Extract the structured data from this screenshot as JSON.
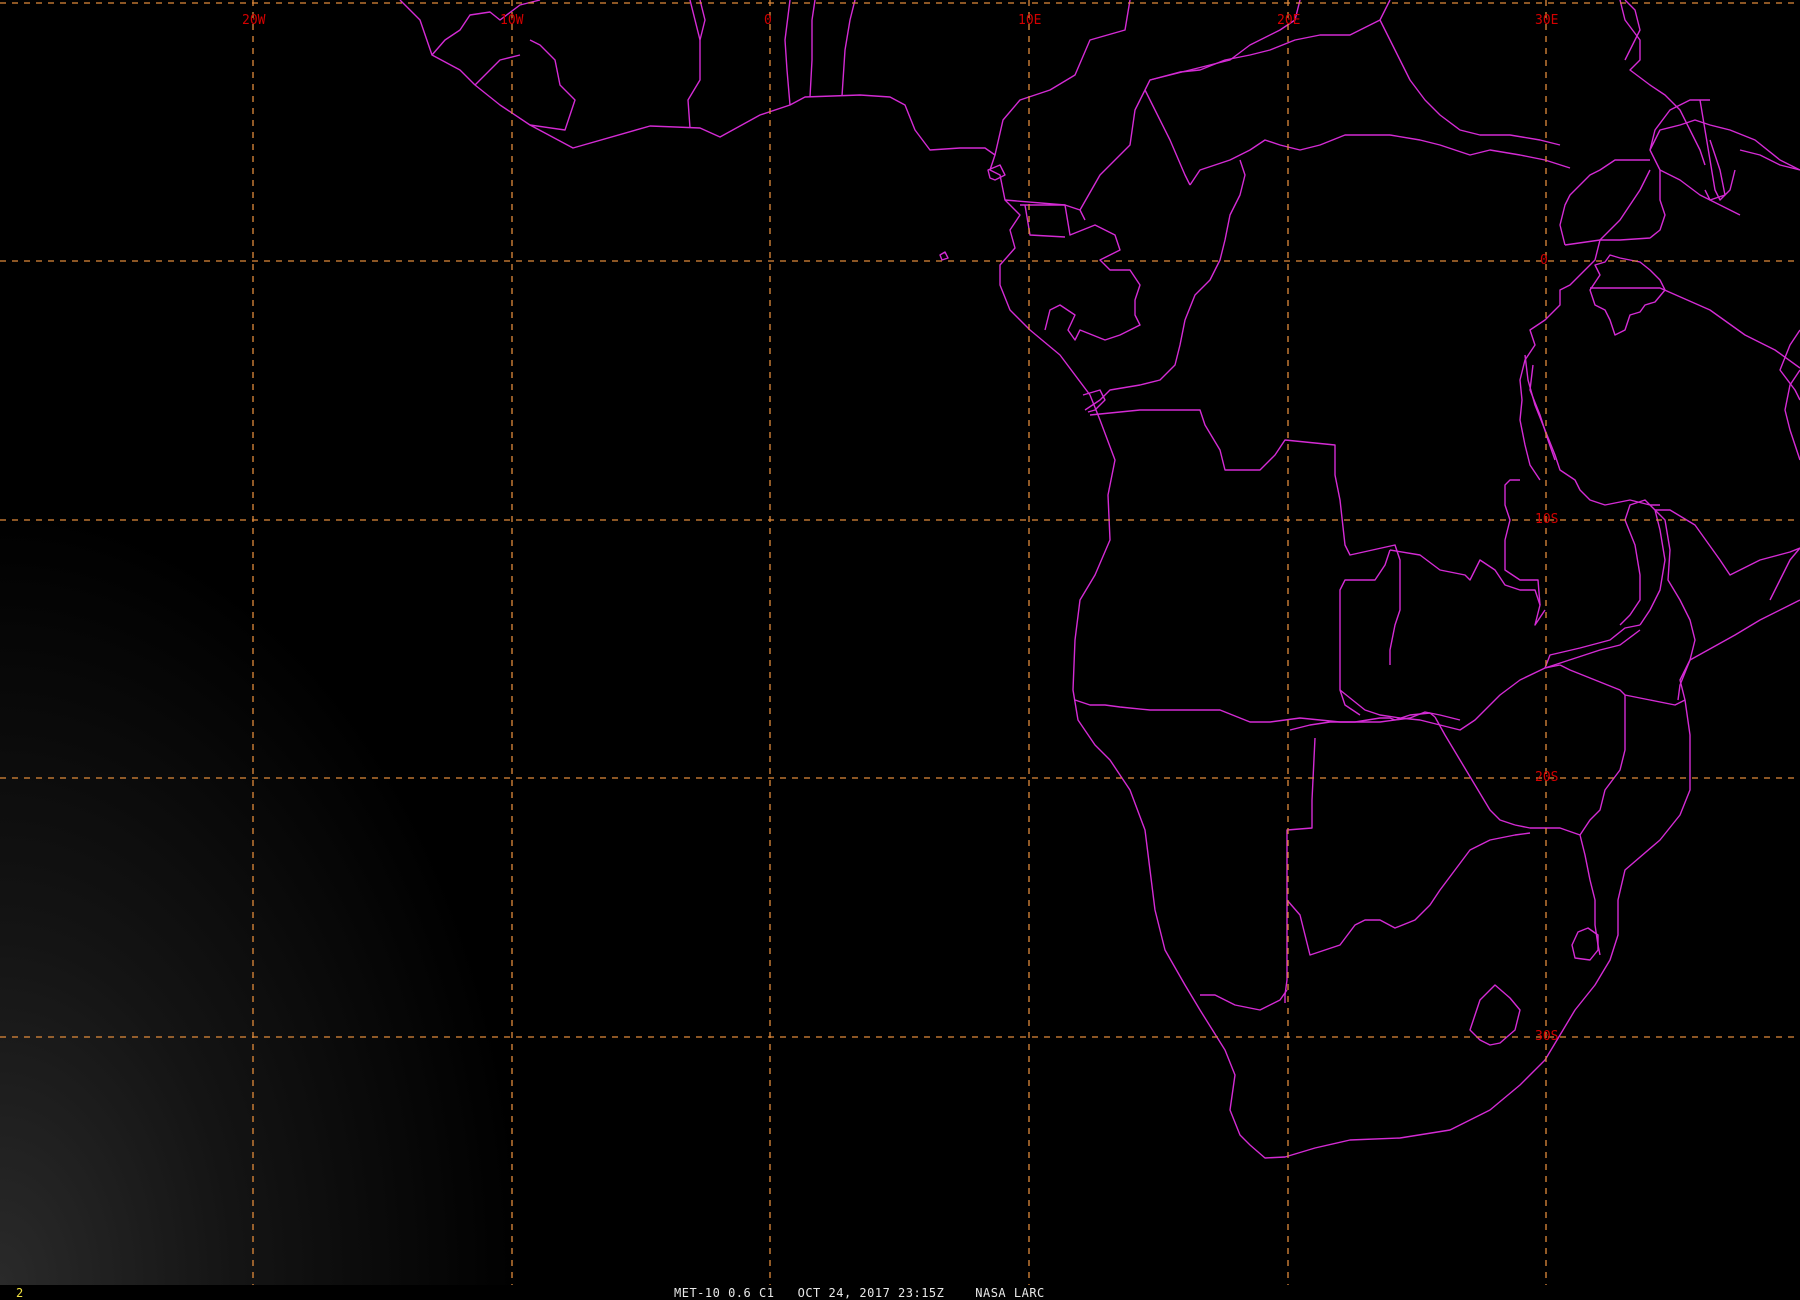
{
  "map": {
    "longitude_labels": [
      "20W",
      "10W",
      "0",
      "10E",
      "20E",
      "30E"
    ],
    "latitude_labels": [
      "0",
      "10S",
      "20S",
      "30S"
    ],
    "colors": {
      "background": "#000000",
      "coastline": "#d42bd4",
      "gridline": "#e08a3a",
      "grid_label": "#d40000",
      "frame_number": "#f0e040"
    }
  },
  "status_bar": {
    "frame_number": "2",
    "text": "MET-10 0.6 C1   OCT 24, 2017 23:15Z    NASA LARC"
  }
}
